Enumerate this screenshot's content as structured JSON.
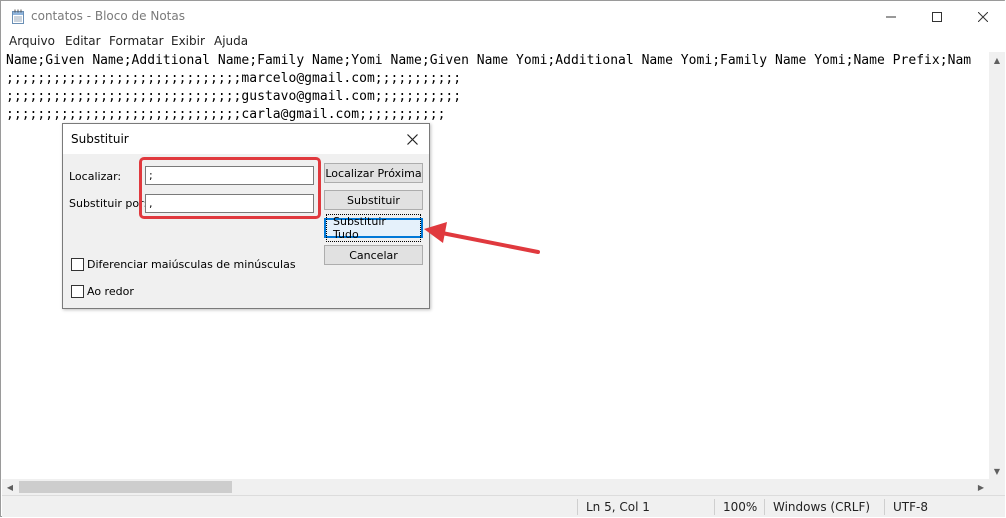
{
  "window": {
    "title": "contatos - Bloco de Notas",
    "controls": {
      "minimize": "—",
      "maximize": "☐",
      "close": "✕"
    }
  },
  "menu": [
    "Arquivo",
    "Editar",
    "Formatar",
    "Exibir",
    "Ajuda"
  ],
  "editor": {
    "lines": [
      "Name;Given Name;Additional Name;Family Name;Yomi Name;Given Name Yomi;Additional Name Yomi;Family Name Yomi;Name Prefix;Nam",
      ";;;;;;;;;;;;;;;;;;;;;;;;;;;;;;marcelo@gmail.com;;;;;;;;;;;",
      ";;;;;;;;;;;;;;;;;;;;;;;;;;;;;;gustavo@gmail.com;;;;;;;;;;;",
      ";;;;;;;;;;;;;;;;;;;;;;;;;;;;;;carla@gmail.com;;;;;;;;;;;"
    ]
  },
  "status": {
    "position": "Ln 5, Col 1",
    "zoom": "100%",
    "line_ending": "Windows (CRLF)",
    "encoding": "UTF-8"
  },
  "dialog": {
    "title": "Substituir",
    "find_label": "Localizar:",
    "find_value": ";",
    "replace_label": "Substituir por:",
    "replace_value": ",",
    "buttons": {
      "find_next": "Localizar Próxima",
      "replace": "Substituir",
      "replace_all": "Substituir Tudo",
      "cancel": "Cancelar"
    },
    "match_case_label": "Diferenciar maiúsculas de minúsculas",
    "wrap_around_label": "Ao redor",
    "match_case_checked": false,
    "wrap_around_checked": false
  },
  "annotation": {
    "color": "#e0393e"
  },
  "icons": {
    "app": "notepad-icon",
    "dialog_close": "close-icon",
    "scroll_up": "arrow-up-icon",
    "scroll_down": "arrow-down-icon",
    "scroll_left": "arrow-left-icon",
    "scroll_right": "arrow-right-icon"
  }
}
